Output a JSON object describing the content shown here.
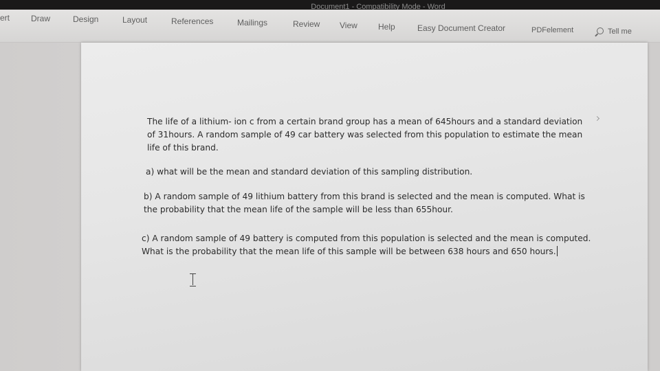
{
  "window": {
    "title": "Document1 - Compatibility Mode - Word"
  },
  "ribbon": {
    "tabs": [
      "ert",
      "Draw",
      "Design",
      "Layout",
      "References",
      "Mailings",
      "Review",
      "View",
      "Help",
      "Easy Document Creator",
      "PDFelement"
    ],
    "tell_me": "Tell me",
    "tell_me_icon": "search-icon"
  },
  "document": {
    "paragraphs": [
      "The life of a lithium- ion c from a certain brand group has a mean of 645hours and a standard deviation of 31hours. A random sample of 49 car battery was selected from this population to estimate the mean life of this brand.",
      "a) what will be the mean and standard deviation of this sampling distribution.",
      "b) A random sample of 49 lithium battery from this brand is selected and the mean is computed. What is the probability that the mean life of the sample will be less than 655hour.",
      "c) A random sample of 49 battery is computed from this population is selected and the mean is computed. What is the probability that the mean life of this sample will be between 638 hours and 650 hours."
    ]
  },
  "colors": {
    "titlebar": "#1a1919",
    "ribbon": "#dedddc",
    "page": "#e8e8e8",
    "text": "#2b2b2b"
  }
}
